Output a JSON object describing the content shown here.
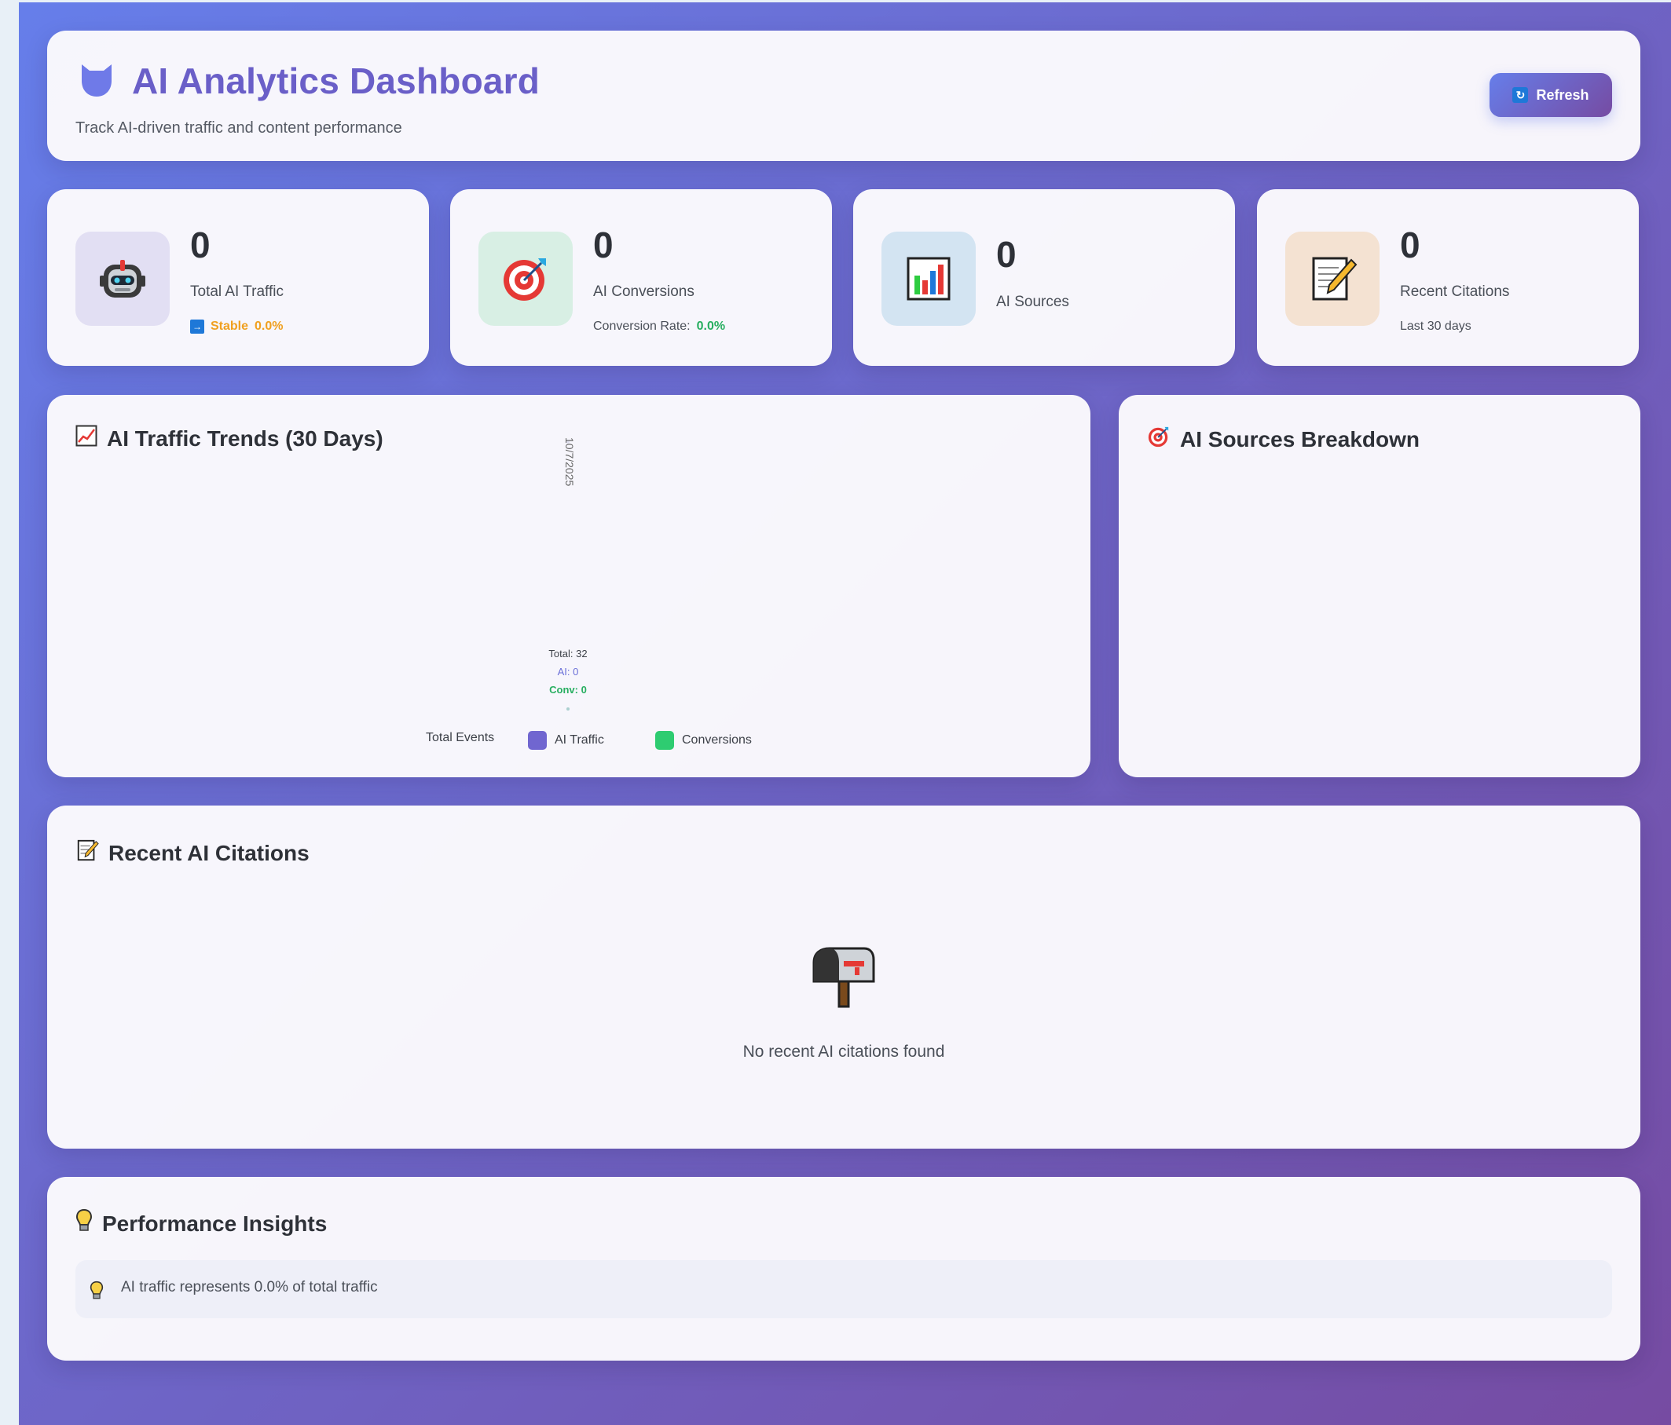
{
  "header": {
    "title": "AI Analytics Dashboard",
    "subtitle": "Track AI-driven traffic and content performance",
    "refresh_label": "Refresh",
    "logo_icon": "shield-icon",
    "refresh_icon": "refresh-icon"
  },
  "stats": [
    {
      "icon": "robot-icon",
      "value": "0",
      "label": "Total AI Traffic",
      "trend_icon": "arrow-right-icon",
      "trend_label": "Stable",
      "trend_value": "0.0%",
      "trend_color": "#f0a020"
    },
    {
      "icon": "target-icon",
      "value": "0",
      "label": "AI Conversions",
      "sub_label": "Conversion Rate:",
      "sub_value": "0.0%",
      "sub_color": "#27ae60"
    },
    {
      "icon": "bar-chart-icon",
      "value": "0",
      "label": "AI Sources"
    },
    {
      "icon": "memo-icon",
      "value": "0",
      "label": "Recent Citations",
      "sub_label": "Last 30 days"
    }
  ],
  "trends": {
    "title": "AI Traffic Trends (30 Days)",
    "title_icon": "chart-increasing-icon",
    "date_label": "10/7/2025",
    "tooltip": {
      "total": "Total: 32",
      "ai": "AI: 0",
      "conv": "Conv: 0"
    },
    "legend": [
      {
        "label": "Total Events",
        "color": ""
      },
      {
        "label": "AI Traffic",
        "color": "#7066d0"
      },
      {
        "label": "Conversions",
        "color": "#2ecc71"
      }
    ]
  },
  "chart_data": {
    "type": "line",
    "x": [
      "10/7/2025"
    ],
    "series": [
      {
        "name": "Total Events",
        "values": [
          32
        ]
      },
      {
        "name": "AI Traffic",
        "values": [
          0
        ]
      },
      {
        "name": "Conversions",
        "values": [
          0
        ]
      }
    ],
    "title": "AI Traffic Trends (30 Days)",
    "xlabel": "",
    "ylabel": "",
    "legend_position": "bottom"
  },
  "sources": {
    "title": "AI Sources Breakdown",
    "title_icon": "target-icon"
  },
  "citations": {
    "title": "Recent AI Citations",
    "title_icon": "memo-icon",
    "empty_icon": "mailbox-icon",
    "empty_text": "No recent AI citations found"
  },
  "insights": {
    "title": "Performance Insights",
    "title_icon": "lightbulb-icon",
    "items": [
      {
        "icon": "lightbulb-icon",
        "text": "AI traffic represents 0.0% of total traffic"
      }
    ]
  },
  "colors": {
    "gradient_start": "#667eea",
    "gradient_end": "#764ba2",
    "title_color": "#6a5fc8"
  }
}
